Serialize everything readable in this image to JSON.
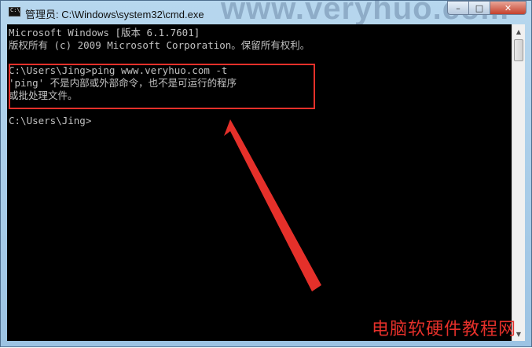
{
  "window": {
    "title": "管理员: C:\\Windows\\system32\\cmd.exe",
    "watermark_top": "www.veryhuo.com",
    "caption": {
      "minimize": "–",
      "maximize": "□",
      "close": "✕"
    }
  },
  "console": {
    "lines": [
      "Microsoft Windows [版本 6.1.7601]",
      "版权所有 (c) 2009 Microsoft Corporation。保留所有权利。",
      "",
      "C:\\Users\\Jing>ping www.veryhuo.com -t",
      "'ping' 不是内部或外部命令，也不是可运行的程序",
      "或批处理文件。",
      "",
      "C:\\Users\\Jing>"
    ]
  },
  "scrollbar": {
    "up_icon": "▲",
    "down_icon": "▼"
  },
  "watermark_bottom": "电脑软硬件教程网",
  "colors": {
    "annotation": "#e5302a",
    "console_bg": "#000000",
    "console_text": "#c0c0c0"
  }
}
